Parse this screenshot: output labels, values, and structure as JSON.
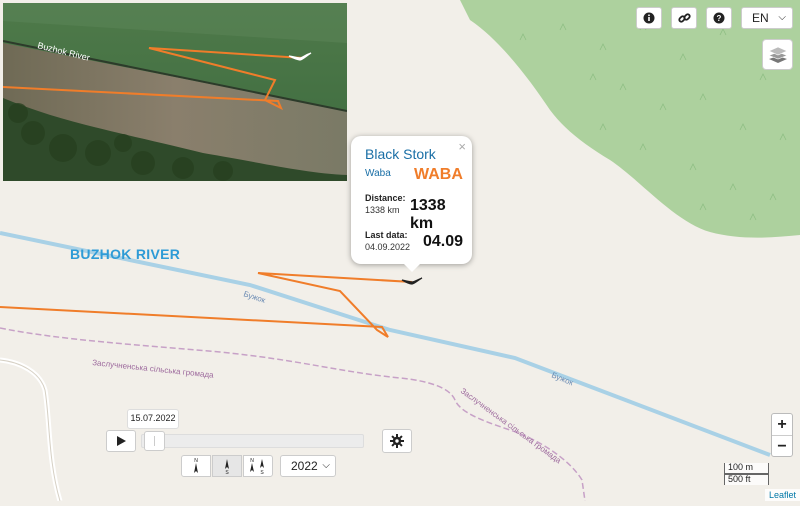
{
  "map": {
    "river_label_big": "BUZHOK RIVER",
    "river_label_map_1": "Бужок",
    "river_label_map_2": "Бужок",
    "community_label_1": "Заслучненська сільська громада",
    "community_label_2": "Заслучненська сільська громада",
    "colors": {
      "track": "#f07d2a",
      "river": "#a9d1e6",
      "forest": "#a8d9a0",
      "land": "#f2efe9",
      "boundary": "#c7a1c7"
    }
  },
  "inset": {
    "river_label": "Buzhok River"
  },
  "popup": {
    "title": "Black Stork",
    "subtitle": "Waba",
    "name_big": "WABA",
    "distance_label": "Distance:",
    "distance_value": "1338 km",
    "distance_big": "1338 km",
    "last_data_label": "Last data:",
    "last_data_value": "04.09.2022",
    "last_data_big": "04.09",
    "close_glyph": "×"
  },
  "controls": {
    "info_icon": "info-icon",
    "link_icon": "link-icon",
    "help_icon": "help-icon",
    "language": "EN",
    "layers_icon": "layers-icon",
    "zoom_in": "+",
    "zoom_out": "−"
  },
  "timeline": {
    "date": "15.07.2022",
    "year": "2022",
    "progress": 0.0
  },
  "scale": {
    "metric": "100 m",
    "imperial": "500 ft"
  },
  "attribution": "Leaflet"
}
